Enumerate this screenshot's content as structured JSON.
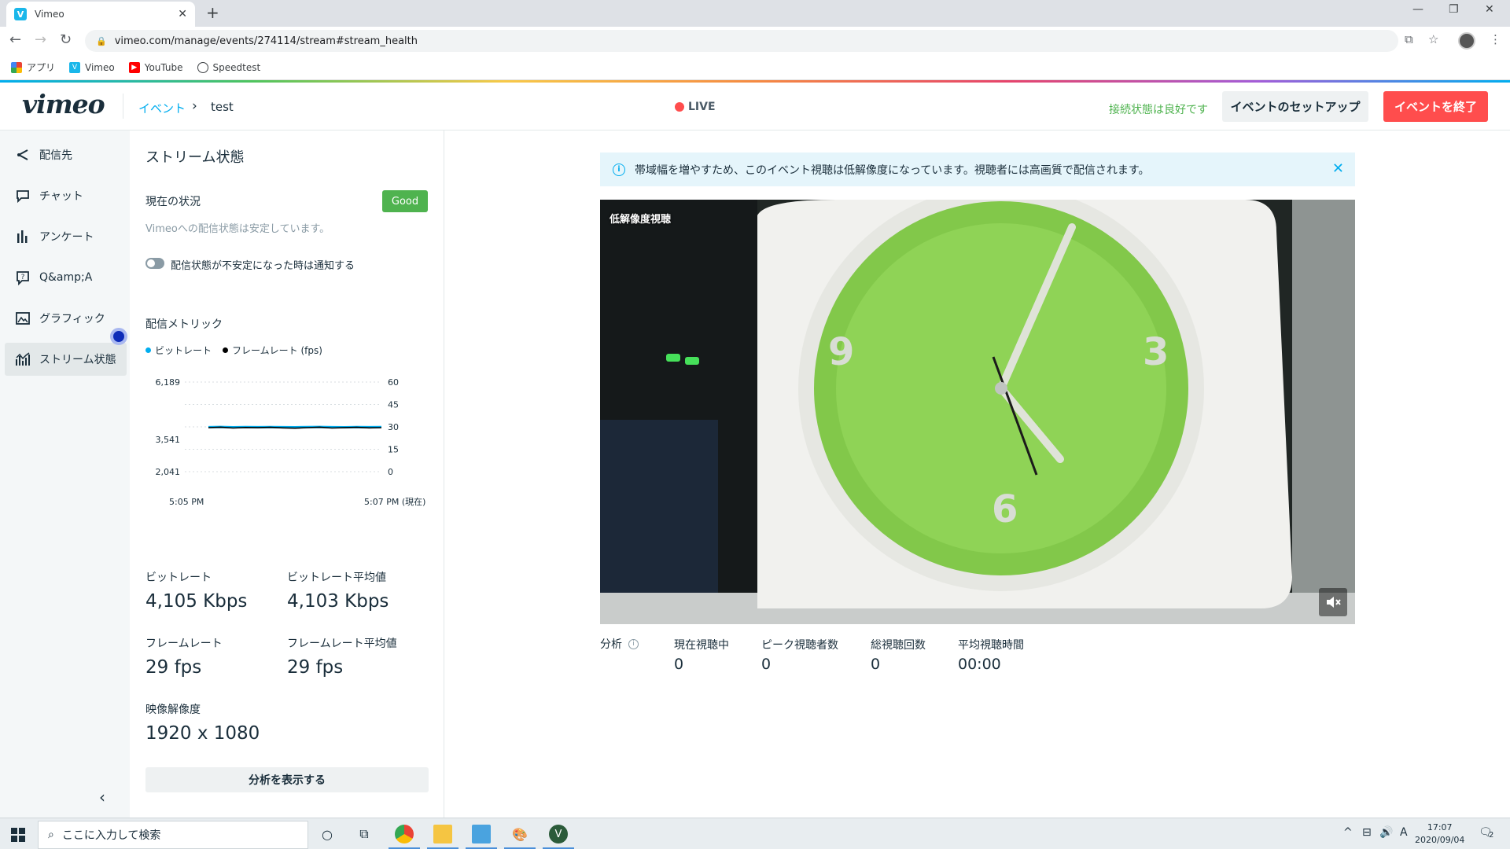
{
  "browser": {
    "tab_title": "Vimeo",
    "url": "vimeo.com/manage/events/274114/stream#stream_health",
    "bookmarks": [
      {
        "label": "アプリ"
      },
      {
        "label": "Vimeo"
      },
      {
        "label": "YouTube"
      },
      {
        "label": "Speedtest"
      }
    ]
  },
  "header": {
    "logo": "vimeo",
    "breadcrumb_link": "イベント",
    "breadcrumb_current": "test",
    "live_label": "LIVE",
    "connection_status": "接続状態は良好です",
    "setup_button": "イベントのセットアップ",
    "end_button": "イベントを終了"
  },
  "sidebar": {
    "items": [
      {
        "label": "配信先",
        "icon": "share-icon"
      },
      {
        "label": "チャット",
        "icon": "chat-icon"
      },
      {
        "label": "アンケート",
        "icon": "poll-icon"
      },
      {
        "label": "Q&amp;A",
        "icon": "qa-icon"
      },
      {
        "label": "グラフィック",
        "icon": "image-icon"
      },
      {
        "label": "ストリーム状態",
        "icon": "stream-health-icon",
        "active": true
      }
    ]
  },
  "panel": {
    "title": "ストリーム状態",
    "current_status_label": "現在の状況",
    "status_badge": "Good",
    "status_message": "Vimeoへの配信状態は安定しています。",
    "notify_toggle_label": "配信状態が不安定になった時は通知する",
    "metrics_title": "配信メトリック",
    "legend": {
      "bitrate": "ビットレート",
      "framerate": "フレームレート (fps)"
    },
    "metrics": {
      "bitrate_label": "ビットレート",
      "bitrate_value": "4,105 Kbps",
      "bitrate_avg_label": "ビットレート平均値",
      "bitrate_avg_value": "4,103 Kbps",
      "framerate_label": "フレームレート",
      "framerate_value": "29 fps",
      "framerate_avg_label": "フレームレート平均値",
      "framerate_avg_value": "29 fps",
      "resolution_label": "映像解像度",
      "resolution_value": "1920 x 1080"
    },
    "analysis_button": "分析を表示する"
  },
  "chart_data": {
    "type": "line",
    "left_axis_ticks": [
      "6,189",
      "3,541",
      "2,041"
    ],
    "right_axis_ticks": [
      "60",
      "45",
      "30",
      "15",
      "0"
    ],
    "x_tick_labels": [
      "5:05 PM",
      "5:07 PM (現在)"
    ],
    "series": [
      {
        "name": "ビットレート",
        "color": "#00adef",
        "values": [
          4100,
          4110,
          4095,
          4105,
          4100,
          4108,
          4102,
          4096,
          4104,
          4110,
          4100,
          4098,
          4106,
          4102,
          4105
        ]
      },
      {
        "name": "フレームレート (fps)",
        "color": "#000000",
        "values": [
          29.5,
          29.8,
          29.2,
          29.6,
          29.4,
          29.7,
          29.3,
          29.1,
          29.5,
          29.8,
          29.2,
          29.4,
          29.7,
          29.3,
          29.5
        ]
      }
    ],
    "y_left_range": [
      2041,
      6189
    ],
    "y_right_range": [
      0,
      60
    ],
    "grid": true
  },
  "main": {
    "banner_text": "帯域幅を増やすため、このイベント視聴は低解像度になっています。視聴者には高画質で配信されます。",
    "video_label": "低解像度視聴",
    "stats_title": "分析",
    "stats": [
      {
        "label": "現在視聴中",
        "value": "0"
      },
      {
        "label": "ピーク視聴者数",
        "value": "0"
      },
      {
        "label": "総視聴回数",
        "value": "0"
      },
      {
        "label": "平均視聴時間",
        "value": "00:00"
      }
    ]
  },
  "taskbar": {
    "search_placeholder": "ここに入力して検索",
    "time": "17:07",
    "date": "2020/09/04",
    "ime": "A",
    "notifications": "2"
  }
}
